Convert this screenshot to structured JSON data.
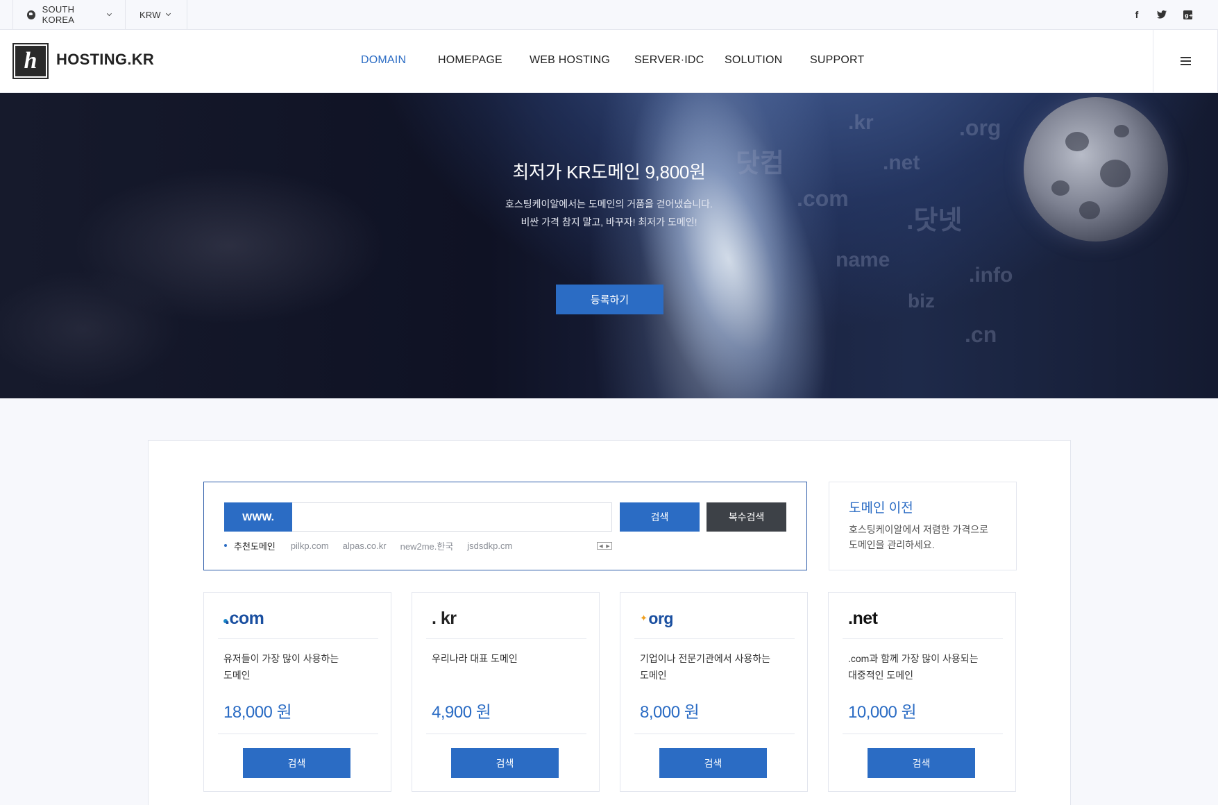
{
  "topbar": {
    "country": "SOUTH KOREA",
    "currency": "KRW",
    "social": [
      {
        "name": "facebook-icon",
        "glyph": "f"
      },
      {
        "name": "twitter-icon",
        "glyph": "t"
      },
      {
        "name": "google-plus-icon",
        "glyph": "g"
      }
    ]
  },
  "header": {
    "logo_mark": "h",
    "logo_text": "HOSTING.KR",
    "nav": [
      "DOMAIN",
      "HOMEPAGE",
      "WEB HOSTING",
      "SERVER·IDC",
      "SOLUTION",
      "SUPPORT"
    ],
    "active_nav": "DOMAIN"
  },
  "hero": {
    "title": "최저가 KR도메인 9,800원",
    "sub1": "호스팅케이알에서는 도메인의 거품을 걷어냈습니다.",
    "sub2": "비싼 가격 참지 말고, 바꾸자! 최저가 도메인!",
    "button": "등록하기",
    "decor": [
      ".kr",
      ".org",
      "닷컴",
      ".net",
      ".com",
      ".닷넷",
      "name",
      ".info",
      "biz",
      ".cn"
    ]
  },
  "search": {
    "prefix": "WWW.",
    "input_value": "",
    "search_button": "검색",
    "multi_button": "복수검색",
    "recommend_label": "추천도메인",
    "suggestions": [
      "pilkp.com",
      "alpas.co.kr",
      "new2me.한국",
      "jsdsdkp.cm"
    ]
  },
  "transfer": {
    "title": "도메인 이전",
    "desc1": "호스팅케이알에서 저렴한 가격으로",
    "desc2": "도메인을 관리하세요."
  },
  "cards": [
    {
      "tld": ".com",
      "accent": "#1a88c9",
      "color": "#1a4fa0",
      "desc1": "유저들이 가장 많이 사용하는",
      "desc2": "도메인",
      "price": "18,000 원",
      "button": "검색"
    },
    {
      "tld": ". kr",
      "accent": "#2b6cc4",
      "color": "#222222",
      "desc1": "우리나라 대표 도메인",
      "desc2": "",
      "price": "4,900 원",
      "button": "검색"
    },
    {
      "tld": "org",
      "accent": "#f0a020",
      "color": "#1a4fa0",
      "desc1": "기업이나 전문기관에서 사용하는",
      "desc2": "도메인",
      "price": "8,000 원",
      "button": "검색"
    },
    {
      "tld": ".net",
      "accent": "#f0b400",
      "color": "#111111",
      "desc1": ".com과 함께 가장 많이 사용되는",
      "desc2": "대중적인 도메인",
      "price": "10,000 원",
      "button": "검색"
    }
  ],
  "colors": {
    "brand": "#2b6cc4",
    "dark_button": "#3d4147"
  }
}
